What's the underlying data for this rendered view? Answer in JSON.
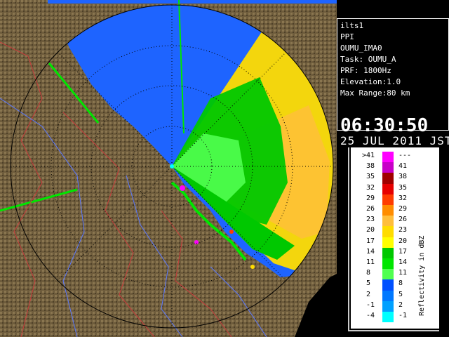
{
  "radar": {
    "site": "ilts1",
    "scan_type": "PPI",
    "volume": "OUMU_IMA0",
    "task": "Task: OUMU_A",
    "prf": "PRF: 1800Hz",
    "elevation": "Elevation:1.0",
    "max_range": "Max Range:80 km",
    "time": "06:30:50",
    "date": "25 JUL 2011 JST"
  },
  "legend": {
    "unit_label": "Reflectivity in dBZ",
    "bins": [
      {
        "left": ">41",
        "right": "---",
        "color": "#ff00ff"
      },
      {
        "left": "38",
        "right": "41",
        "color": "#c800c8"
      },
      {
        "left": "35",
        "right": "38",
        "color": "#a00000"
      },
      {
        "left": "32",
        "right": "35",
        "color": "#e60000"
      },
      {
        "left": "29",
        "right": "32",
        "color": "#ff3c00"
      },
      {
        "left": "26",
        "right": "29",
        "color": "#ff8c00"
      },
      {
        "left": "23",
        "right": "26",
        "color": "#ffbe3c"
      },
      {
        "left": "20",
        "right": "23",
        "color": "#ffdc00"
      },
      {
        "left": "17",
        "right": "20",
        "color": "#ffff00"
      },
      {
        "left": "14",
        "right": "17",
        "color": "#00c800"
      },
      {
        "left": "11",
        "right": "14",
        "color": "#00e600"
      },
      {
        "left": "8",
        "right": "11",
        "color": "#50ff50"
      },
      {
        "left": "5",
        "right": "8",
        "color": "#0050ff"
      },
      {
        "left": "2",
        "right": "5",
        "color": "#0078ff"
      },
      {
        "left": "-1",
        "right": "2",
        "color": "#00a0ff"
      },
      {
        "left": "-4",
        "right": "-1",
        "color": "#00ffff"
      }
    ]
  },
  "colors": {
    "terrain": "#6b5a3a",
    "terrain_dark": "#4a3d26",
    "sea_echo": "#1e64ff",
    "range_ring": "#000000",
    "boundary_red": "#c83c3c",
    "river_blue": "#5a78ff"
  }
}
